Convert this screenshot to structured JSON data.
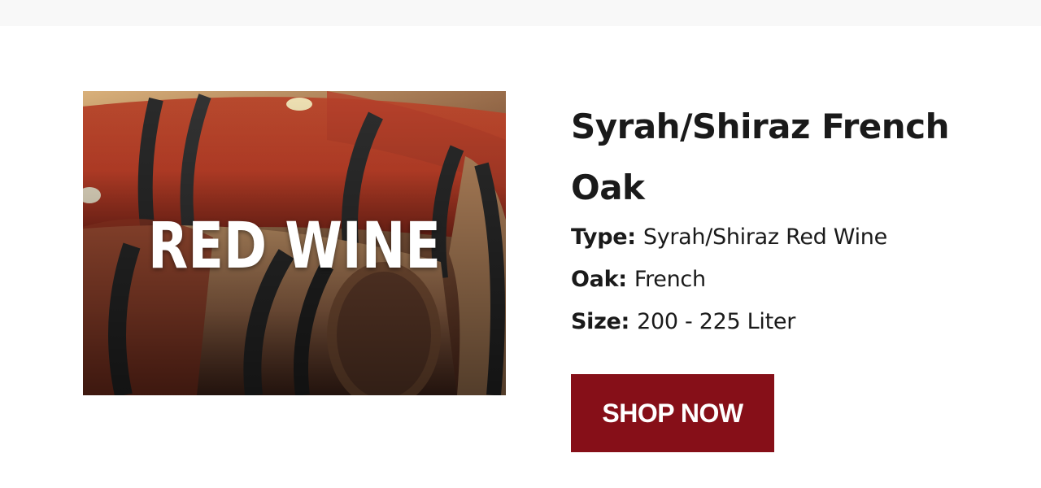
{
  "product": {
    "image_caption": "RED WINE",
    "title": "Syrah/Shiraz French Oak",
    "specs": [
      {
        "label": "Type:",
        "value": "Syrah/Shiraz Red Wine"
      },
      {
        "label": "Oak:",
        "value": "French"
      },
      {
        "label": "Size:",
        "value": "200 - 225 Liter"
      }
    ],
    "cta_label": "SHOP NOW"
  },
  "colors": {
    "button_bg": "#860f18",
    "top_bar": "#f8f8f8",
    "text": "#1a1a1a"
  }
}
